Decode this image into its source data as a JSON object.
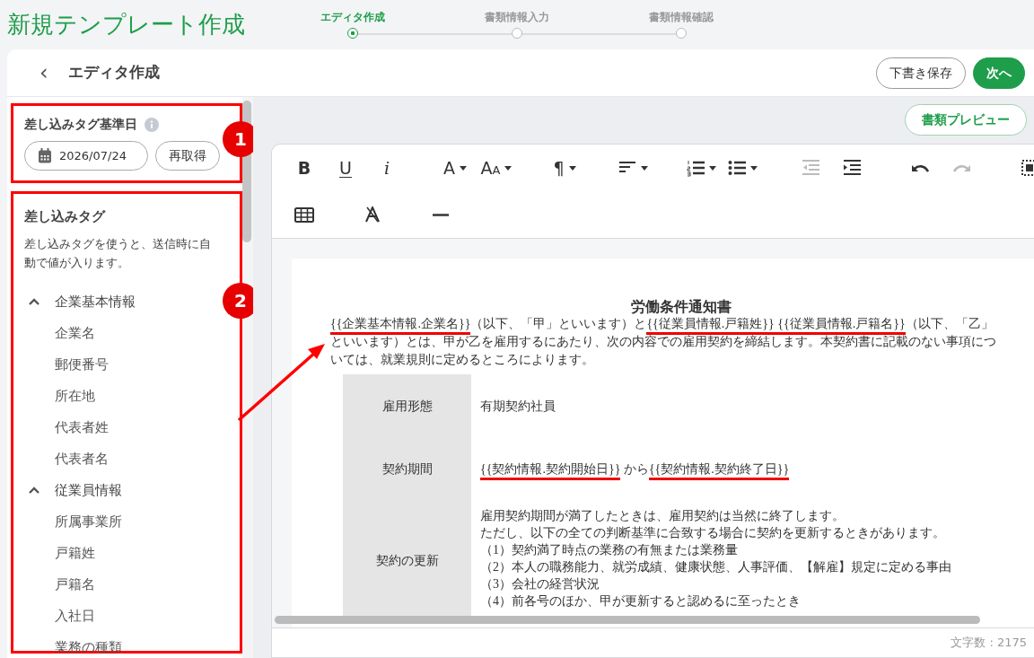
{
  "page_title": "新規テンプレート作成",
  "steps": [
    {
      "label": "エディタ作成",
      "selected": true
    },
    {
      "label": "書類情報入力",
      "selected": false
    },
    {
      "label": "書類情報確認",
      "selected": false
    }
  ],
  "header": {
    "back": "‹",
    "title": "エディタ作成",
    "buttons": [
      {
        "label": "下書き保存",
        "kind": "outline"
      },
      {
        "label": "次へ",
        "kind": "primary"
      }
    ]
  },
  "sidebar": {
    "date_section": {
      "annotation": "1",
      "label": "差し込みタグ基準日",
      "date": "2026/07/24",
      "refresh": "再取得"
    },
    "tag_section": {
      "annotation": "2",
      "title": "差し込みタグ",
      "description": "差し込みタグを使うと、送信時に自動で値が入ります。",
      "groups": [
        {
          "label": "企業基本情報",
          "expanded": true,
          "children": [
            {
              "label": "企業名"
            },
            {
              "label": "郵便番号"
            },
            {
              "label": "所在地"
            },
            {
              "label": "代表者姓"
            },
            {
              "label": "代表者名"
            }
          ]
        },
        {
          "label": "従業員情報",
          "expanded": true,
          "children": [
            {
              "label": "所属事業所"
            },
            {
              "label": "戸籍姓"
            },
            {
              "label": "戸籍名"
            },
            {
              "label": "入社日"
            },
            {
              "label": "業務の種類"
            }
          ]
        }
      ]
    }
  },
  "preview_button": "書類プレビュー",
  "toolbar": {
    "rows": [
      {
        "groups": [
          {
            "items": [
              {
                "kind": "bold",
                "glyph": "B",
                "dropdown": false,
                "disabled": false
              },
              {
                "kind": "underline",
                "glyph": "U",
                "dropdown": false,
                "disabled": false
              },
              {
                "kind": "italic",
                "glyph": "i",
                "dropdown": false,
                "disabled": false
              }
            ]
          },
          {
            "items": [
              {
                "kind": "font-color",
                "glyph": "A",
                "dropdown": true,
                "disabled": false
              },
              {
                "kind": "font-size",
                "glyph": "A",
                "glyph_small": "A",
                "dropdown": true,
                "disabled": false
              }
            ]
          },
          {
            "items": [
              {
                "kind": "paragraph",
                "glyph": "¶",
                "dropdown": true,
                "disabled": false
              }
            ]
          },
          {
            "items": [
              {
                "kind": "align",
                "dropdown": true,
                "disabled": false
              }
            ]
          },
          {
            "items": [
              {
                "kind": "ordered-list",
                "dropdown": true,
                "disabled": false
              },
              {
                "kind": "bullet-list",
                "dropdown": true,
                "disabled": false
              }
            ]
          },
          {
            "items": [
              {
                "kind": "outdent",
                "dropdown": false,
                "disabled": true
              },
              {
                "kind": "indent",
                "dropdown": false,
                "disabled": false
              }
            ]
          },
          {
            "items": [
              {
                "kind": "undo",
                "dropdown": false,
                "disabled": false
              },
              {
                "kind": "redo",
                "dropdown": false,
                "disabled": true
              }
            ]
          },
          {
            "items": [
              {
                "kind": "select-all",
                "dropdown": false,
                "disabled": false
              }
            ]
          }
        ]
      },
      {
        "groups": [
          {
            "items": [
              {
                "kind": "table",
                "dropdown": false,
                "disabled": false
              }
            ]
          },
          {
            "items": [
              {
                "kind": "clear-format",
                "dropdown": false,
                "disabled": false
              }
            ]
          },
          {
            "items": [
              {
                "kind": "horizontal-rule",
                "dropdown": false,
                "disabled": false
              }
            ]
          }
        ]
      }
    ]
  },
  "document": {
    "title": "労働条件通知書",
    "intro": [
      {
        "text": "{{企業基本情報.企業名}}",
        "underlined": true
      },
      {
        "text": "（以下、「甲」といいます）と",
        "underlined": false
      },
      {
        "text": "{{従業員情報.戸籍姓}} {{従業員情報.戸籍名}}",
        "underlined": true
      },
      {
        "text": "（以下、「乙」といいます）とは、甲が乙を雇用するにあたり、次の内容での雇用契約を締結します。本契約書に記載のない事項については、就業規則に定めるところによります。",
        "underlined": false
      }
    ],
    "table": [
      {
        "label": "雇用形態",
        "lines": [
          [
            {
              "text": "有期契約社員",
              "underlined": false
            }
          ]
        ]
      },
      {
        "label": "契約期間",
        "lines": [
          [
            {
              "text": "{{契約情報.契約開始日}}",
              "underlined": true
            },
            {
              "text": " から",
              "underlined": false
            },
            {
              "text": "{{契約情報.契約終了日}}",
              "underlined": true
            }
          ]
        ]
      },
      {
        "label": "契約の更新",
        "lines": [
          [
            {
              "text": "雇用契約期間が満了したときは、雇用契約は当然に終了します。",
              "underlined": false
            }
          ],
          [
            {
              "text": "ただし、以下の全ての判断基準に合致する場合に契約を更新するときがあります。",
              "underlined": false
            }
          ],
          [
            {
              "text": "（1）契約満了時点の業務の有無または業務量",
              "underlined": false
            }
          ],
          [
            {
              "text": "（2）本人の職務能力、就労成績、健康状態、人事評価、【解雇】規定に定める事由",
              "underlined": false
            }
          ],
          [
            {
              "text": "（3）会社の経営状況",
              "underlined": false
            }
          ],
          [
            {
              "text": "（4）前各号のほか、甲が更新すると認めるに至ったとき",
              "underlined": false
            }
          ]
        ]
      }
    ]
  },
  "char_count": "文字数 : 2175"
}
